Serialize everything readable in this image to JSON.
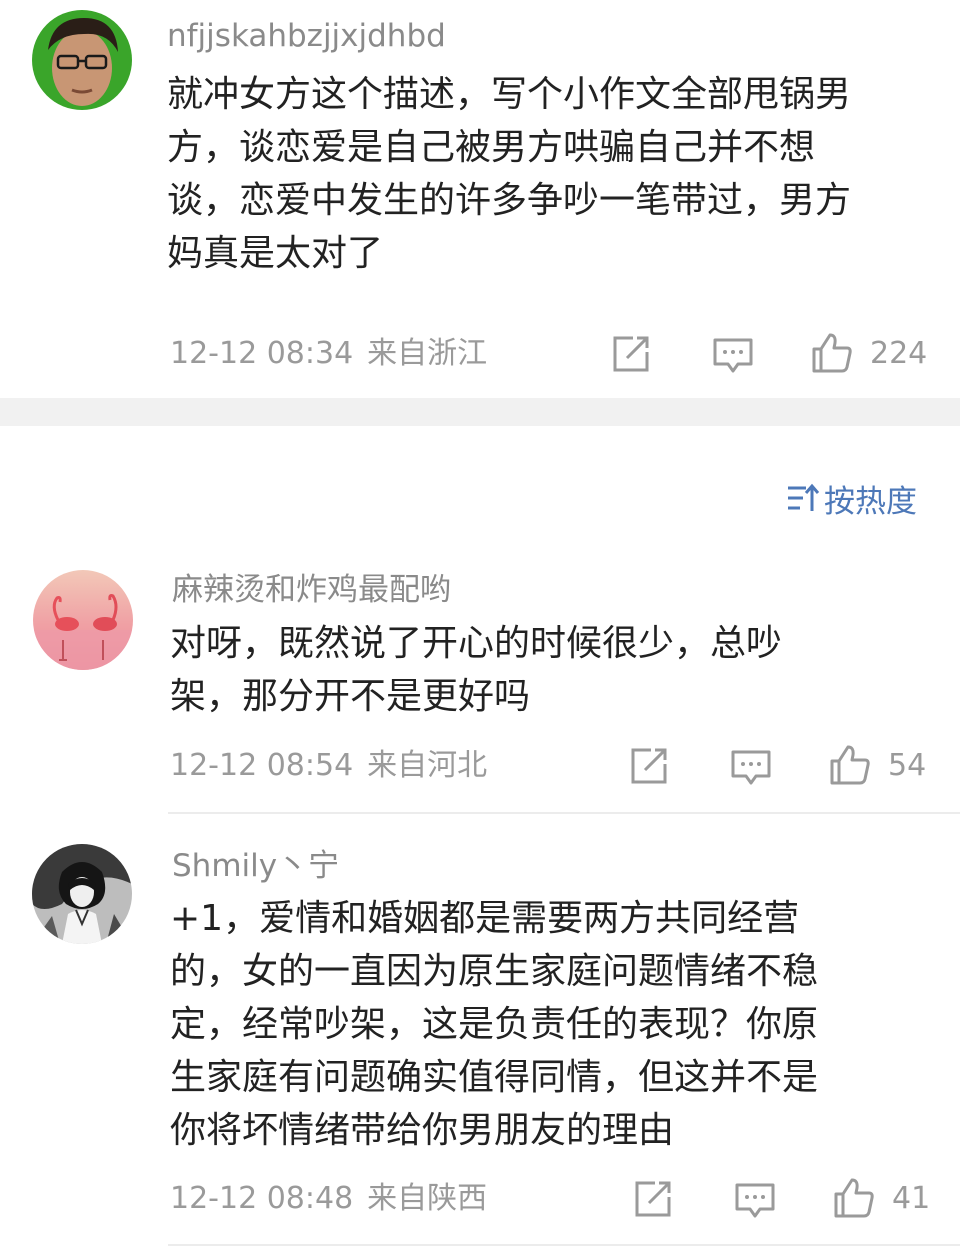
{
  "comments": [
    {
      "username": "nfjjskahbzjjxjdhbd",
      "text_lines": [
        "就冲女方这个描述，写个小作文全部甩锅男",
        "方，谈恋爱是自己被男方哄骗自己并不想",
        "谈，恋爱中发生的许多争吵一笔带过，男方",
        "妈真是太对了"
      ],
      "time": "12-12 08:34",
      "location": "来自浙江",
      "likes": "224"
    },
    {
      "username": "麻辣烫和炸鸡最配哟",
      "text_lines": [
        "对呀，既然说了开心的时候很少，总吵",
        "架，那分开不是更好吗"
      ],
      "time": "12-12 08:54",
      "location": "来自河北",
      "likes": "54"
    },
    {
      "username": "Shmily丶宁",
      "text_lines": [
        "+1，爱情和婚姻都是需要两方共同经营",
        "的，女的一直因为原生家庭问题情绪不稳",
        "定，经常吵架，这是负责任的表现？你原",
        "生家庭有问题确实值得同情，但这并不是",
        "你将坏情绪带给你男朋友的理由"
      ],
      "time": "12-12 08:48",
      "location": "来自陕西",
      "likes": "41"
    }
  ],
  "sort": {
    "label": "按热度",
    "icon": "sort-icon"
  },
  "colors": {
    "accent": "#4d78b8",
    "meta": "#9a9a9a",
    "username": "#8a8a8a",
    "band": "#f1f1f1"
  },
  "icons": [
    "share-icon",
    "comment-icon",
    "like-icon"
  ]
}
